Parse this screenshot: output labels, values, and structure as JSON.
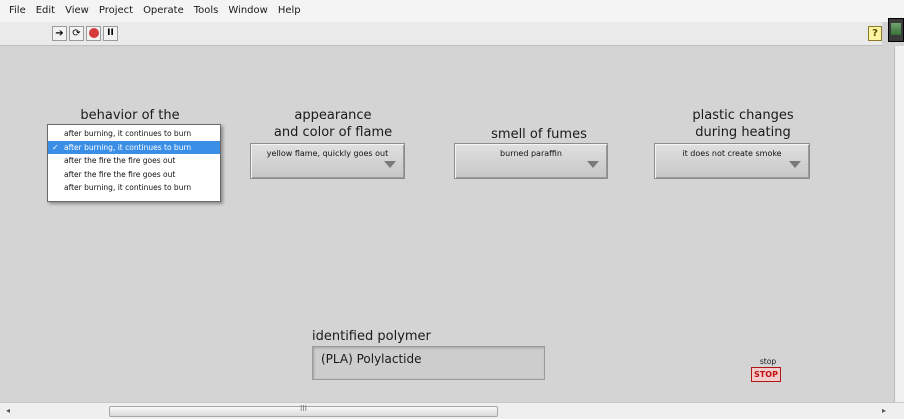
{
  "menu": [
    "File",
    "Edit",
    "View",
    "Project",
    "Operate",
    "Tools",
    "Window",
    "Help"
  ],
  "toolbar": {
    "run_icon": "➔",
    "run_continuously_icon": "⟳",
    "pause_icon": "II",
    "help_icon": "?"
  },
  "controls": {
    "behavior": {
      "label": "behavior of the material",
      "options": [
        "after burning, it continues to burn",
        "after burning, it continues to burn",
        "after the fire the fire goes out",
        "after the fire the fire goes out",
        "after burning, it continues to burn"
      ],
      "selected_index": 1,
      "check": "✓"
    },
    "appearance": {
      "label_line1": "appearance",
      "label_line2": "and color of flame",
      "value": "yellow flame, quickly goes out"
    },
    "smell": {
      "label": "smell of fumes",
      "value": "burned paraffin"
    },
    "plastic": {
      "label_line1": "plastic changes",
      "label_line2": "during heating",
      "value": "it does not create smoke"
    }
  },
  "result": {
    "label": "identified polymer",
    "value": "(PLA) Polylactide"
  },
  "stop": {
    "label": "stop",
    "button": "STOP"
  },
  "scrollbar": {
    "left_arrow": "◂",
    "right_arrow": "▸",
    "grip": "III"
  }
}
